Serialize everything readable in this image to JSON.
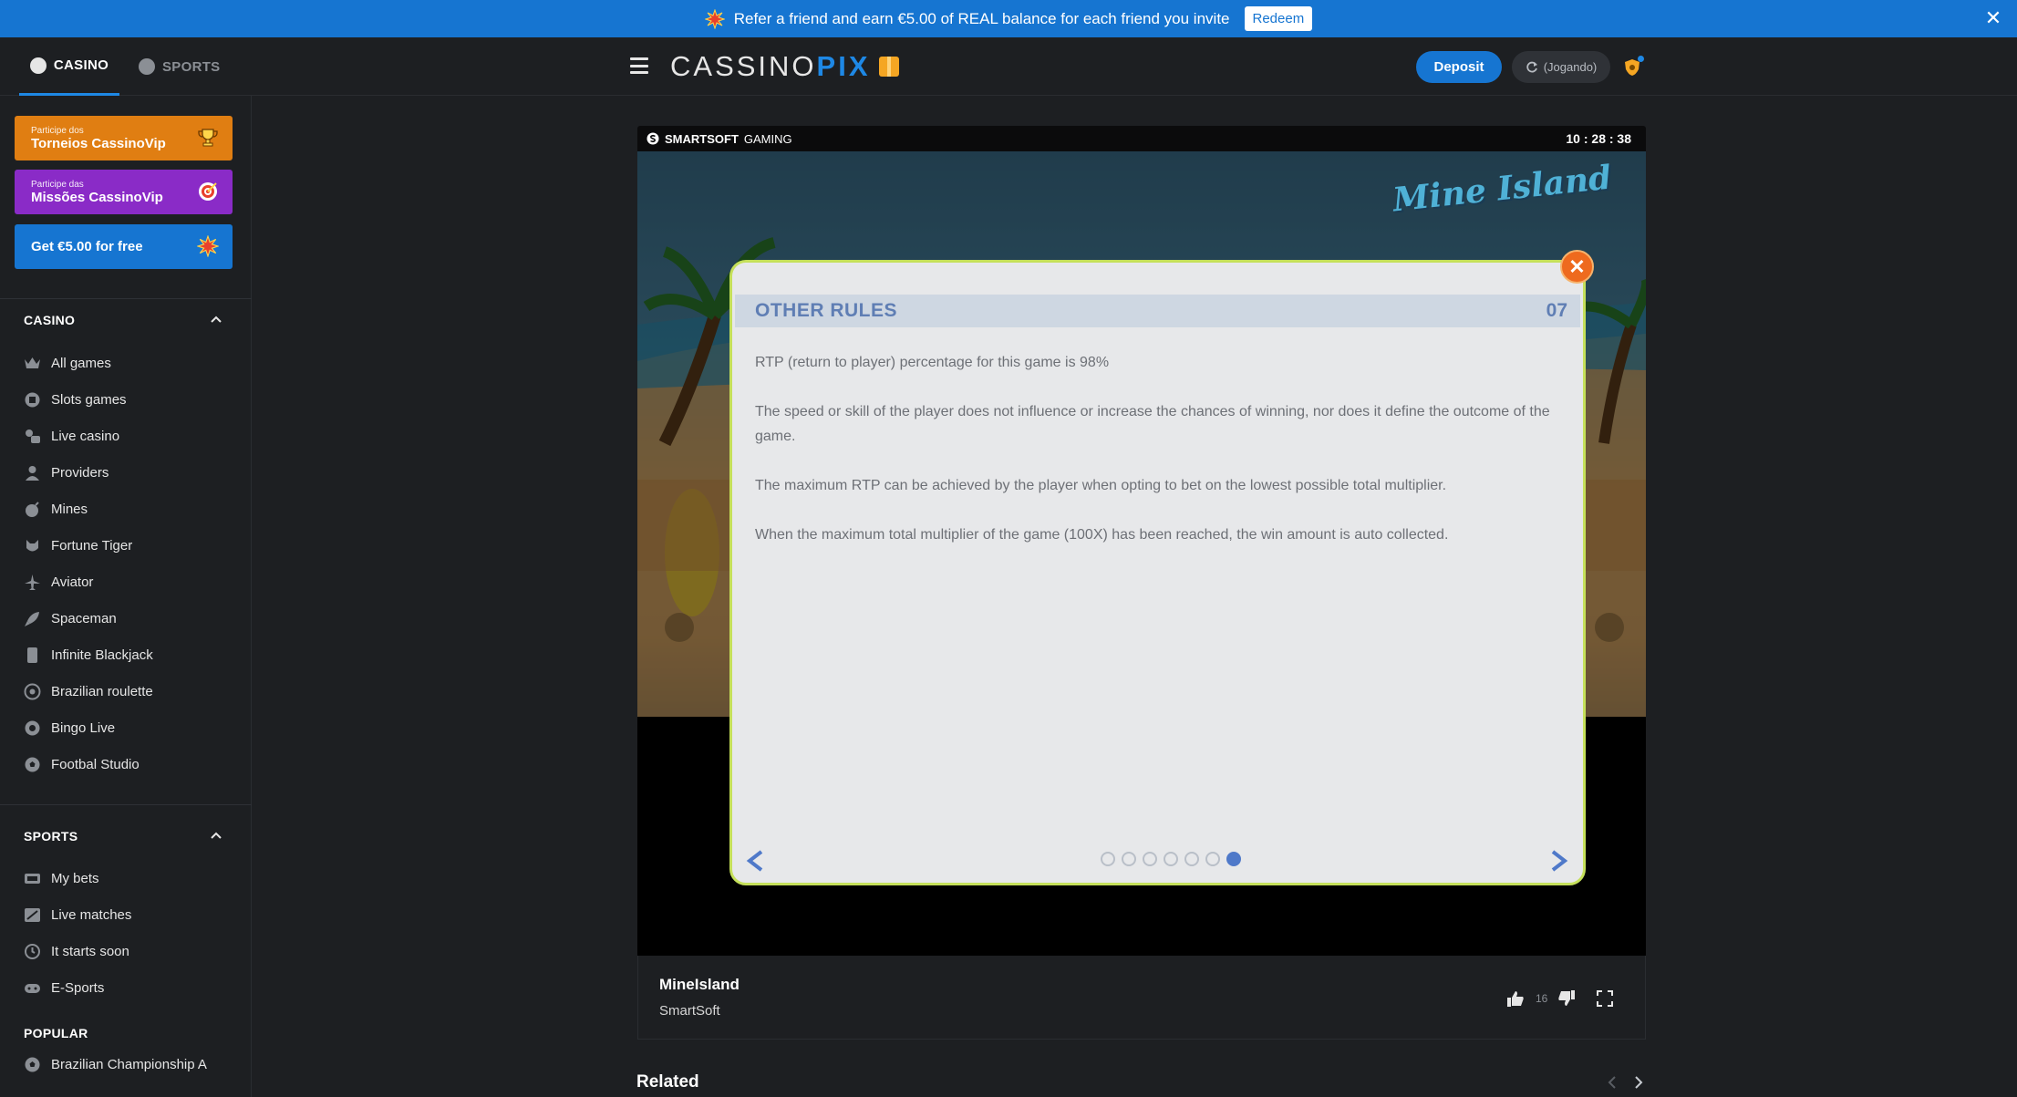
{
  "banner": {
    "text": "Refer a friend and earn €5.00 of REAL balance for each friend you invite",
    "redeem_label": "Redeem",
    "close_icon": "close-icon"
  },
  "header": {
    "tabs": [
      {
        "label": "CASINO",
        "icon": "casino-chip-icon",
        "active": true
      },
      {
        "label": "SPORTS",
        "icon": "soccer-ball-icon",
        "active": false
      }
    ],
    "logo_part1": "CASSINO",
    "logo_part2": "PIX",
    "deposit_label": "Deposit",
    "balance_label": "(Jogando)"
  },
  "sidebar": {
    "promos": [
      {
        "small": "Participe dos",
        "big": "Torneios CassinoVip",
        "icon": "trophy-icon",
        "color": "#e07e12"
      },
      {
        "small": "Participe das",
        "big": "Missões CassinoVip",
        "icon": "target-icon",
        "color": "#8a2bc7"
      },
      {
        "small": "",
        "big": "Get €5.00 for free",
        "icon": "burst-icon",
        "color": "#1675d1"
      }
    ],
    "casino_title": "CASINO",
    "casino_items": [
      {
        "label": "All games",
        "icon": "crown-icon"
      },
      {
        "label": "Slots games",
        "icon": "slots-icon"
      },
      {
        "label": "Live casino",
        "icon": "live-casino-icon"
      },
      {
        "label": "Providers",
        "icon": "user-icon"
      },
      {
        "label": "Mines",
        "icon": "bomb-icon"
      },
      {
        "label": "Fortune Tiger",
        "icon": "tiger-icon"
      },
      {
        "label": "Aviator",
        "icon": "plane-icon"
      },
      {
        "label": "Spaceman",
        "icon": "rocket-icon"
      },
      {
        "label": "Infinite Blackjack",
        "icon": "card-icon"
      },
      {
        "label": "Brazilian roulette",
        "icon": "roulette-icon"
      },
      {
        "label": "Bingo Live",
        "icon": "bingo-icon"
      },
      {
        "label": "Footbal Studio",
        "icon": "football-icon"
      }
    ],
    "sports_title": "SPORTS",
    "sports_items": [
      {
        "label": "My bets",
        "icon": "ticket-icon"
      },
      {
        "label": "Live matches",
        "icon": "live-field-icon"
      },
      {
        "label": "It starts soon",
        "icon": "clock-icon"
      },
      {
        "label": "E-Sports",
        "icon": "gamepad-icon"
      }
    ],
    "popular_title": "POPULAR",
    "popular_items": [
      {
        "label": "Brazilian Championship A",
        "icon": "soccer-ball-icon"
      }
    ]
  },
  "game": {
    "provider_bold": "SMARTSOFT",
    "provider_rest": "GAMING",
    "clock": "10 : 28 : 38",
    "title": "MineIsland",
    "provider_name": "SmartSoft",
    "likes": "16",
    "logo_text": "Mine Island"
  },
  "modal": {
    "title": "OTHER RULES",
    "page_number": "07",
    "rules": [
      "RTP (return to player) percentage for this game is 98%",
      "The speed or skill of the player does not influence or increase the chances of winning, nor does it define the outcome of the game.",
      "The maximum RTP can be achieved by the player when opting to bet on the lowest possible total multiplier.",
      "When the maximum total multiplier of the game (100X) has been reached, the win amount is auto collected."
    ],
    "total_pages": 7,
    "active_page": 7,
    "accent_color": "#5f7eb4",
    "border_color": "#c5e05a"
  },
  "related": {
    "title": "Related"
  }
}
